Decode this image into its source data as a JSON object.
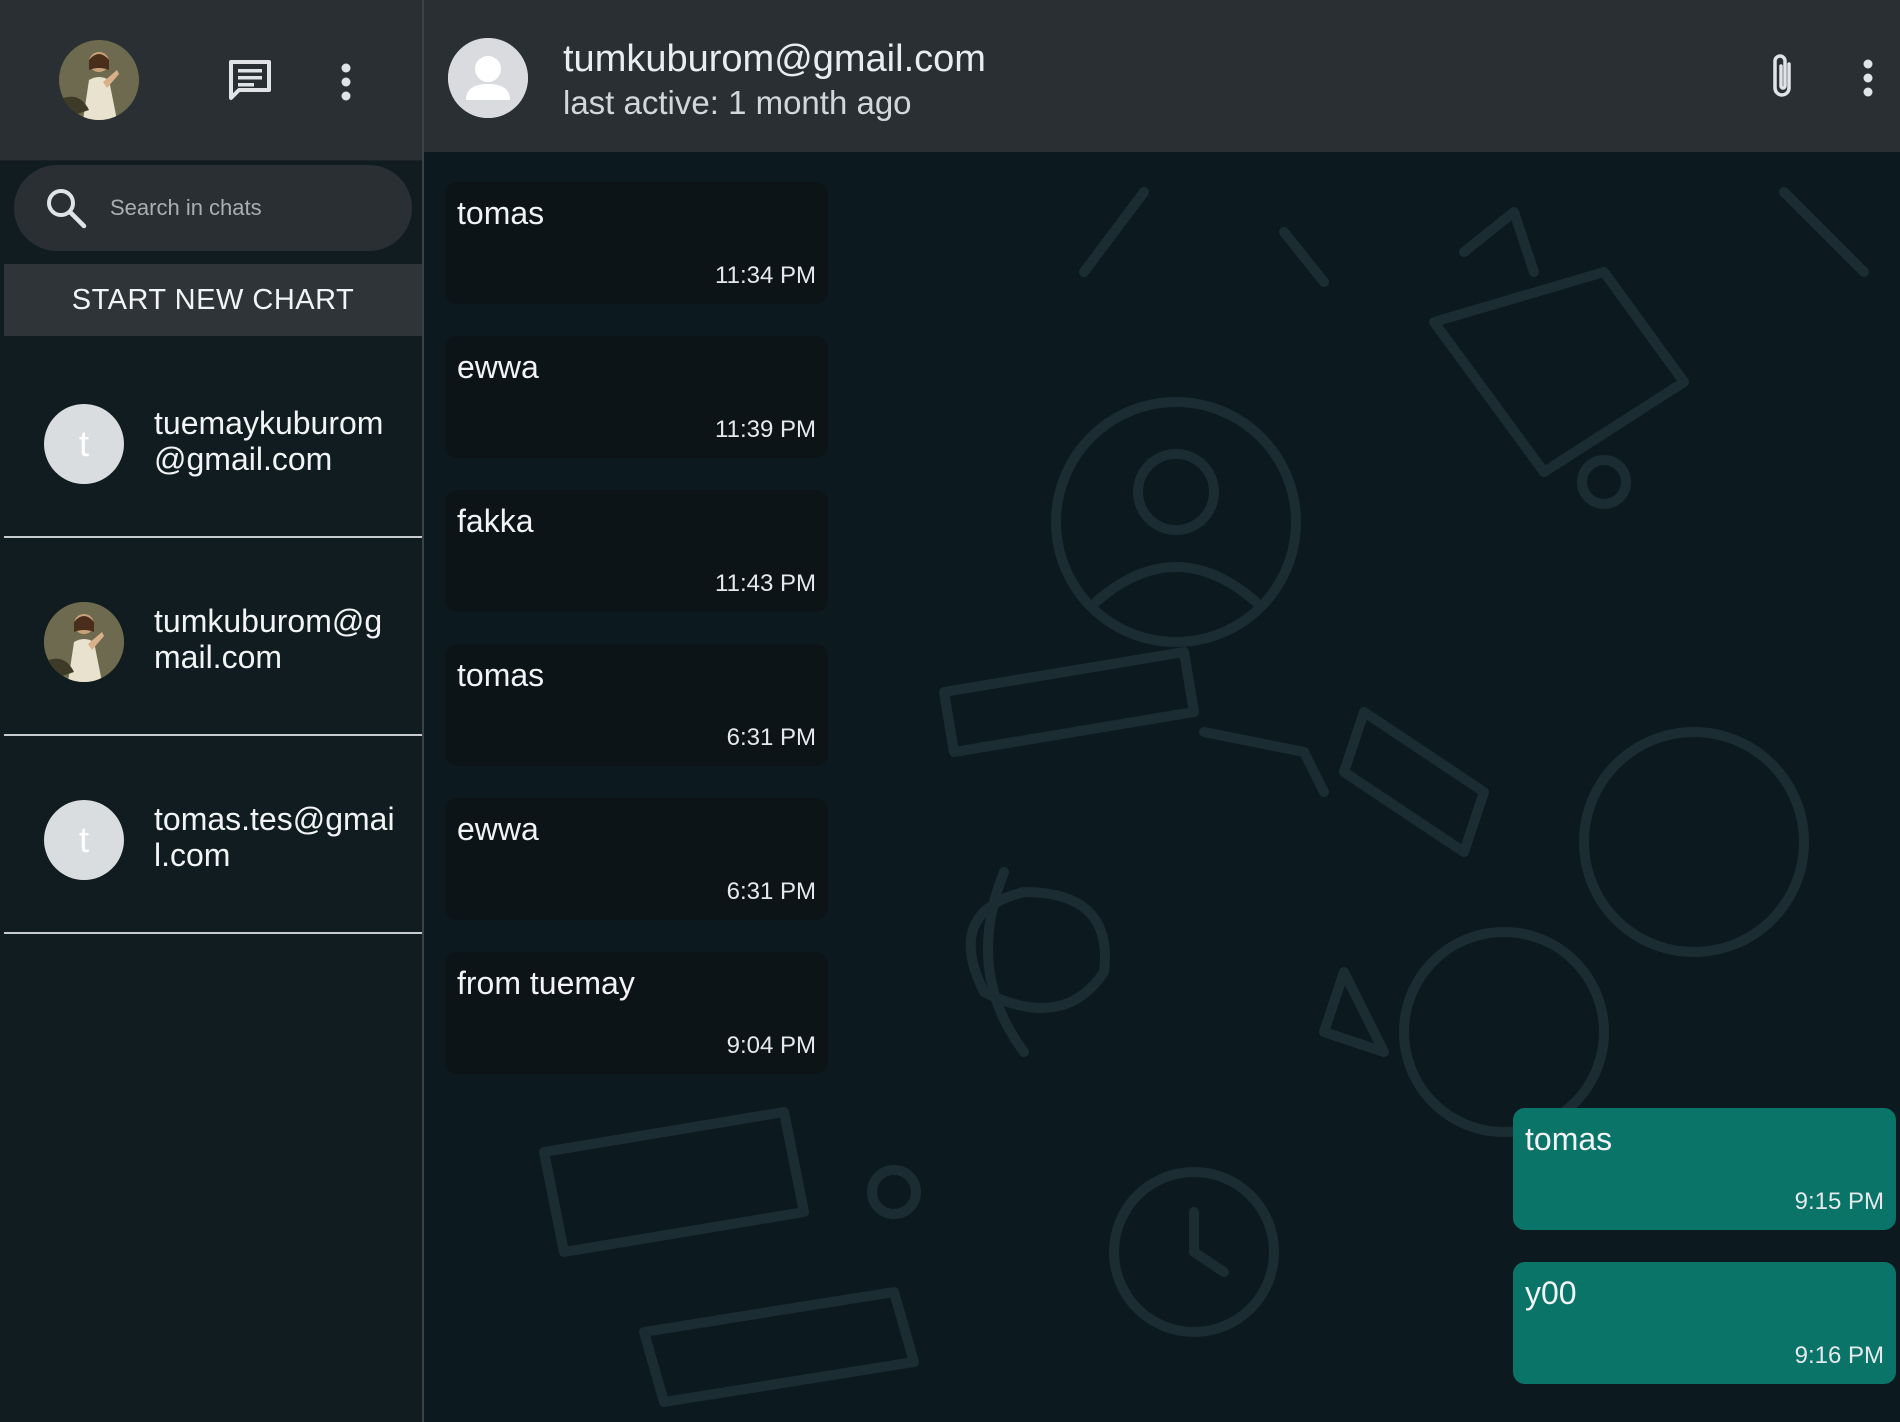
{
  "sidebar": {
    "search": {
      "placeholder": "Search in chats"
    },
    "new_chat_label": "START NEW CHART",
    "chats": [
      {
        "name": "tuemaykuburom@gmail.com",
        "initial": "t",
        "avatar": "letter"
      },
      {
        "name": "tumkuburom@gmail.com",
        "initial": "",
        "avatar": "photo"
      },
      {
        "name": "tomas.tes@gmail.com",
        "initial": "t",
        "avatar": "letter"
      }
    ]
  },
  "header": {
    "contact_name": "tumkuburom@gmail.com",
    "status": "last active: 1 month ago"
  },
  "messages": [
    {
      "text": "tomas",
      "time": "11:34 PM",
      "direction": "in"
    },
    {
      "text": "ewwa",
      "time": "11:39 PM",
      "direction": "in"
    },
    {
      "text": "fakka",
      "time": "11:43 PM",
      "direction": "in"
    },
    {
      "text": "tomas",
      "time": "6:31 PM",
      "direction": "in"
    },
    {
      "text": "ewwa",
      "time": "6:31 PM",
      "direction": "in"
    },
    {
      "text": "from tuemay",
      "time": "9:04 PM",
      "direction": "in"
    },
    {
      "text": "tomas",
      "time": "9:15 PM",
      "direction": "out"
    },
    {
      "text": "y00",
      "time": "9:16 PM",
      "direction": "out"
    }
  ],
  "colors": {
    "sidebar_bg": "#111c20",
    "header_bg": "#2a2f33",
    "chat_bg": "#0c1a20",
    "incoming_bubble": "#0d1418",
    "outgoing_bubble": "#0b7469"
  }
}
